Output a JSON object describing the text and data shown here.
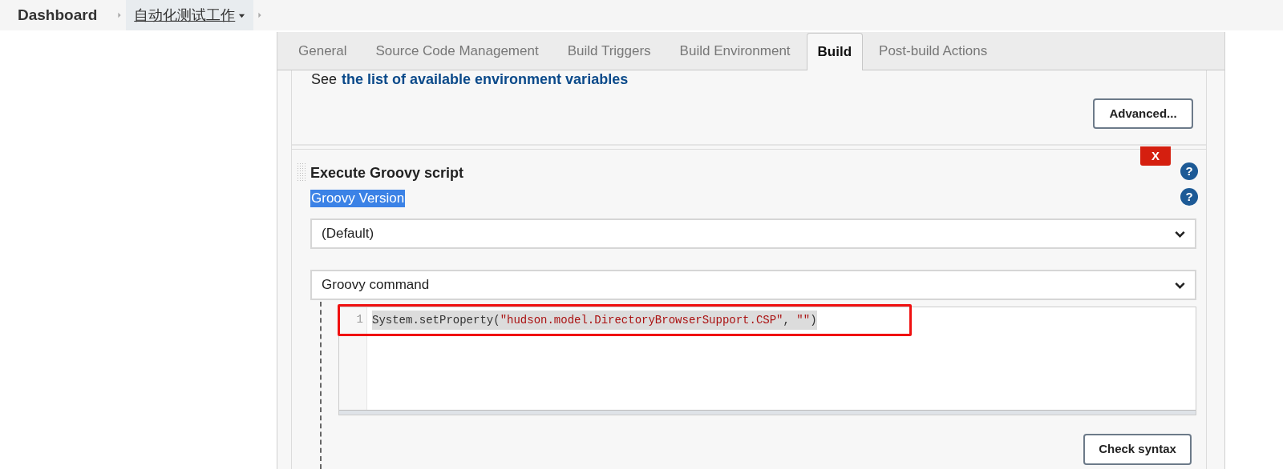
{
  "breadcrumbs": [
    {
      "label": "Dashboard",
      "kind": "root"
    },
    {
      "label": "自动化测试工作",
      "kind": "job",
      "selected": true
    }
  ],
  "tabs": [
    {
      "label": "General",
      "selected": false
    },
    {
      "label": "Source Code Management",
      "selected": false
    },
    {
      "label": "Build Triggers",
      "selected": false
    },
    {
      "label": "Build Environment",
      "selected": false
    },
    {
      "label": "Build",
      "selected": true
    },
    {
      "label": "Post-build Actions",
      "selected": false
    }
  ],
  "env_note": {
    "prefix": "See",
    "link": "the list of available environment variables"
  },
  "advanced_button": "Advanced...",
  "build_step": {
    "title": "Execute Groovy script",
    "delete": "X",
    "help": "?",
    "version_label": {
      "text": "Groovy Version",
      "highlighted": true,
      "help": "?"
    },
    "version_select": "(Default)",
    "command_select": "Groovy command",
    "code_lines": [
      {
        "number": "1",
        "selected": true,
        "tokens": [
          {
            "text": "System.setProperty(",
            "kind": "plain"
          },
          {
            "text": "\"hudson.model.DirectoryBrowserSupport.CSP\"",
            "kind": "string"
          },
          {
            "text": ", ",
            "kind": "plain"
          },
          {
            "text": "\"\"",
            "kind": "string"
          },
          {
            "text": ")",
            "kind": "plain"
          }
        ]
      }
    ],
    "check_button": "Check syntax"
  }
}
